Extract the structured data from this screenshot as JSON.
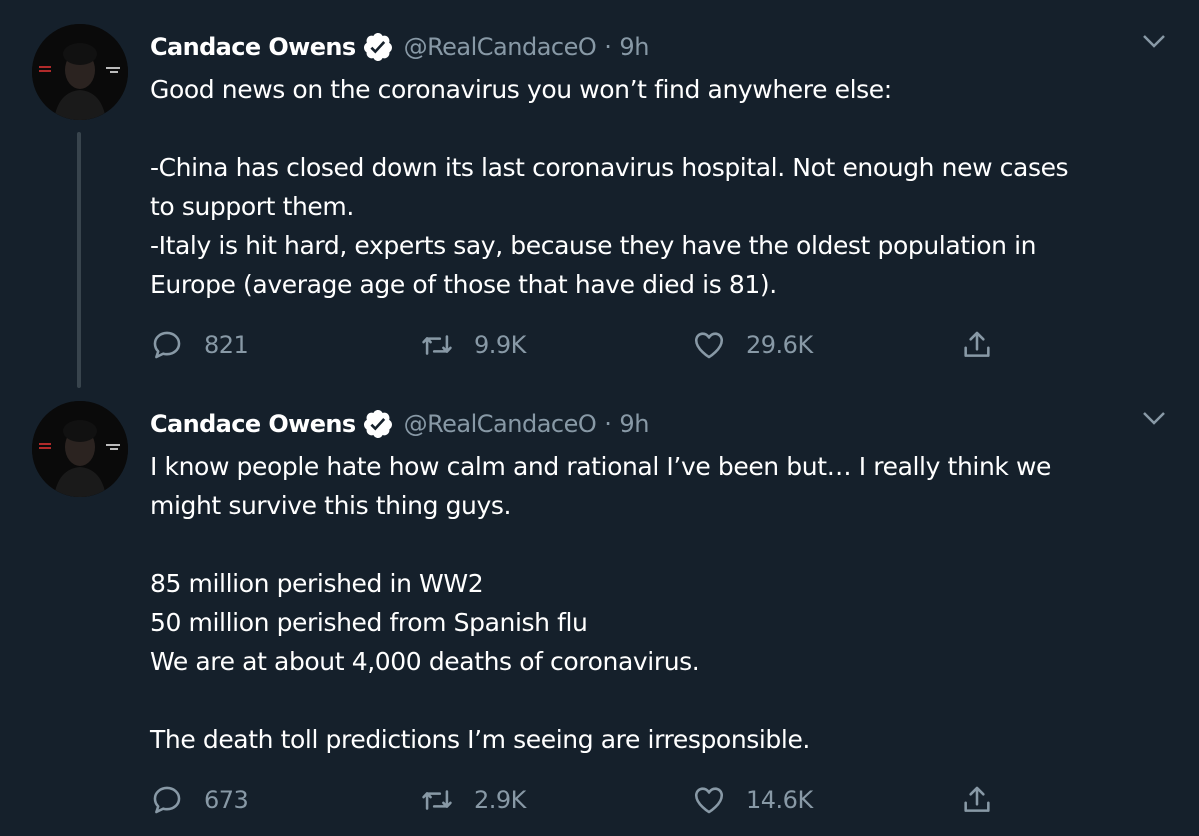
{
  "tweets": [
    {
      "author_name": "Candace Owens",
      "handle": "@RealCandaceO",
      "separator": "·",
      "time": "9h",
      "lines": [
        "Good news on the coronavirus you won’t find anywhere else:",
        "",
        "-China has closed down its last coronavirus hospital. Not enough new cases",
        "to support them.",
        "-Italy is hit hard, experts say, because they have the oldest population in",
        "Europe (average age of those that have died is 81)."
      ],
      "replies": "821",
      "retweets": "9.9K",
      "likes": "29.6K"
    },
    {
      "author_name": "Candace Owens",
      "handle": "@RealCandaceO",
      "separator": "·",
      "time": "9h",
      "lines": [
        "I know people hate how calm and rational I’ve been but… I really think we",
        "might survive this thing guys.",
        "",
        "85 million perished in WW2",
        "50 million perished from Spanish flu",
        "We are at about 4,000 deaths of coronavirus.",
        "",
        "The death toll predictions I’m seeing are irresponsible."
      ],
      "replies": "673",
      "retweets": "2.9K",
      "likes": "14.6K"
    }
  ],
  "colors": {
    "background": "#15202b",
    "text_primary": "#ffffff",
    "text_secondary": "#8899a6",
    "verified_badge": "#ffffff",
    "thread_line": "#38444d"
  },
  "icons": {
    "verified": "verified-badge-icon",
    "caret": "chevron-down-icon",
    "reply": "reply-bubble-icon",
    "retweet": "retweet-icon",
    "like": "heart-icon",
    "share": "share-upload-icon"
  }
}
